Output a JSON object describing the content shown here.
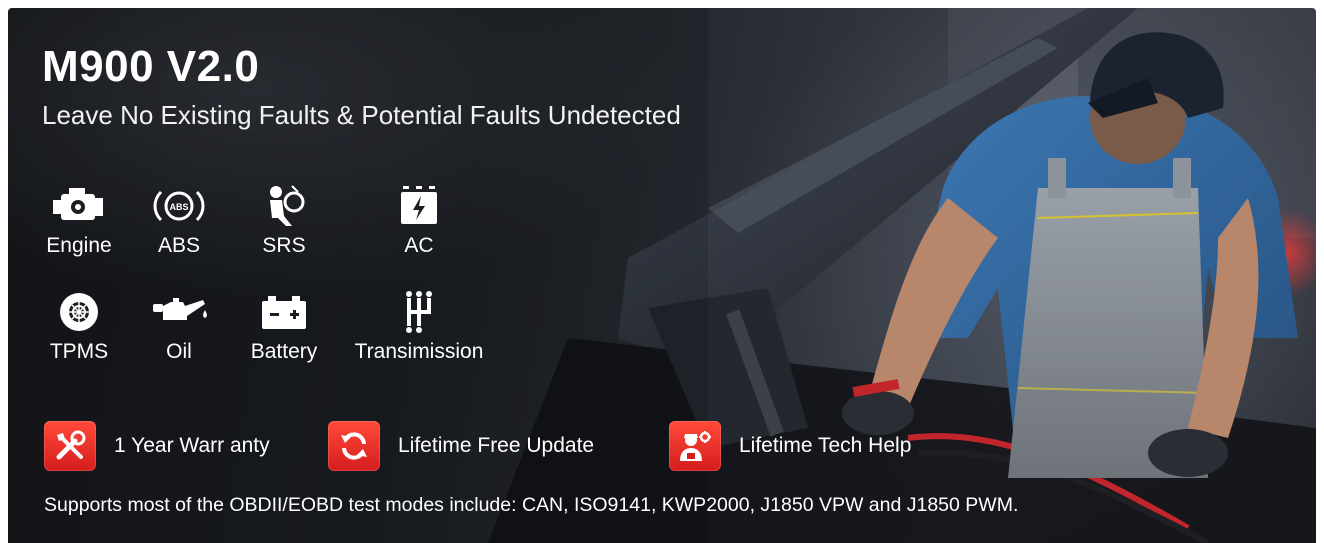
{
  "banner": {
    "title": "M900 V2.0",
    "subtitle": "Leave No Existing Faults & Potential Faults Undetected",
    "features": [
      {
        "label": "Engine",
        "icon": "engine-icon"
      },
      {
        "label": "ABS",
        "icon": "abs-icon"
      },
      {
        "label": "SRS",
        "icon": "airbag-icon"
      },
      {
        "label": "AC",
        "icon": "ac-icon"
      },
      {
        "label": "TPMS",
        "icon": "tire-icon"
      },
      {
        "label": "Oil",
        "icon": "oil-can-icon"
      },
      {
        "label": "Battery",
        "icon": "battery-icon"
      },
      {
        "label": "Transimission",
        "icon": "gear-shift-icon"
      }
    ],
    "badges": [
      {
        "label": "1 Year Warr anty",
        "icon": "tools-icon"
      },
      {
        "label": "Lifetime Free Update",
        "icon": "refresh-icon"
      },
      {
        "label": "Lifetime Tech Help",
        "icon": "technician-icon"
      }
    ],
    "footnote": "Supports most of the OBDII/EOBD test modes include: CAN, ISO9141, KWP2000, J1850 VPW and J1850 PWM.",
    "colors": {
      "accent_red": "#e0241f",
      "text": "#ffffff",
      "background": "#1b1e23"
    }
  }
}
